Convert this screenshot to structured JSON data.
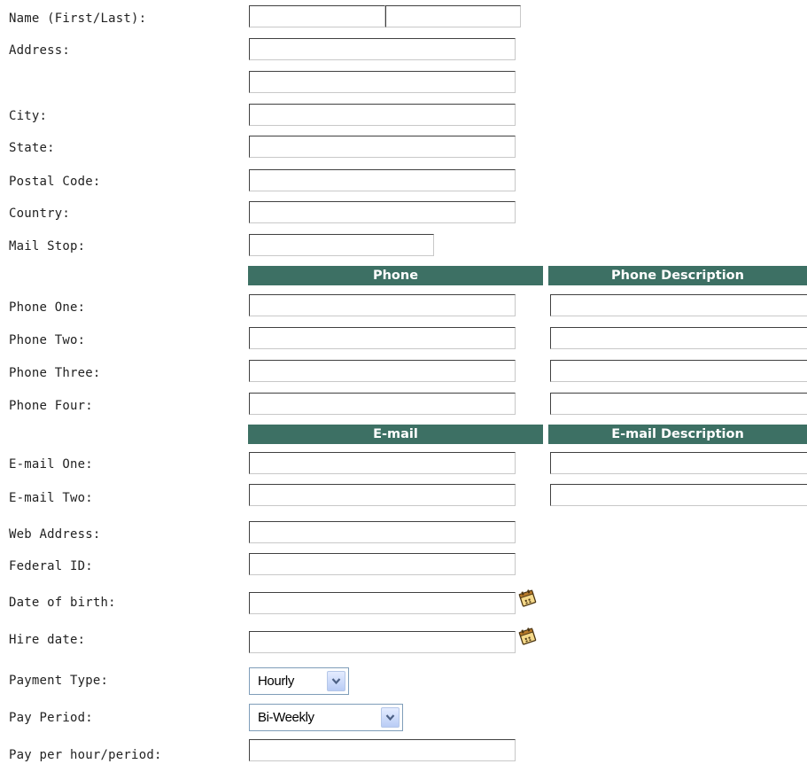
{
  "form": {
    "name_label": "Name (First/Last):",
    "address_label": "Address:",
    "city_label": "City:",
    "state_label": "State:",
    "postal_code_label": "Postal Code:",
    "country_label": "Country:",
    "mail_stop_label": "Mail Stop:",
    "phone_header": "Phone",
    "phone_description_header": "Phone Description",
    "phone_labels": [
      "Phone One:",
      "Phone Two:",
      "Phone Three:",
      "Phone Four:"
    ],
    "email_header": "E-mail",
    "email_description_header": "E-mail Description",
    "email_labels": [
      "E-mail One:",
      "E-mail Two:"
    ],
    "web_address_label": "Web Address:",
    "federal_id_label": "Federal ID:",
    "date_of_birth_label": "Date of birth:",
    "hire_date_label": "Hire date:",
    "payment_type_label": "Payment Type:",
    "payment_type_value": "Hourly",
    "pay_period_label": "Pay Period:",
    "pay_period_value": "Bi-Weekly",
    "pay_per_label": "Pay per hour/period:"
  },
  "icons": {
    "calendar": "calendar-icon",
    "dropdown": "chevron-down-icon"
  },
  "colors": {
    "header_bg": "#3d7064",
    "header_text": "#ffffff",
    "select_border": "#7f9db9"
  }
}
